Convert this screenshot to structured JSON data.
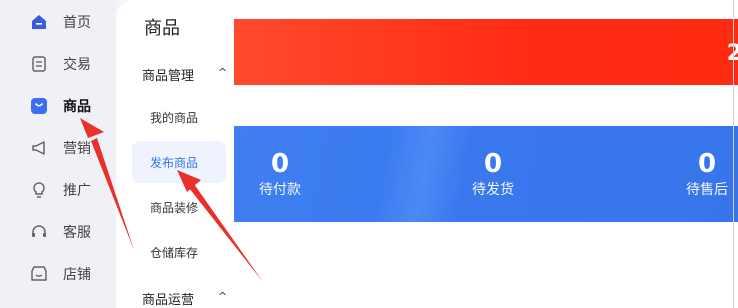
{
  "sidebar": {
    "items": [
      {
        "label": "首页",
        "icon": "home-icon"
      },
      {
        "label": "交易",
        "icon": "receipt-icon"
      },
      {
        "label": "商品",
        "icon": "shopping-bag-icon"
      },
      {
        "label": "营销",
        "icon": "megaphone-icon"
      },
      {
        "label": "推广",
        "icon": "lightbulb-icon"
      },
      {
        "label": "客服",
        "icon": "headset-icon"
      },
      {
        "label": "店铺",
        "icon": "storefront-icon"
      }
    ],
    "active_index": 2
  },
  "submenu": {
    "title": "商品",
    "groups": [
      {
        "label": "商品管理",
        "caret": "^",
        "items": [
          "我的商品",
          "发布商品",
          "商品装修",
          "仓储库存"
        ],
        "active_item": "发布商品"
      },
      {
        "label": "商品运营",
        "caret": "^"
      }
    ]
  },
  "banner": {
    "value_fragment": "2"
  },
  "stats": [
    {
      "value": "0",
      "label": "待付款"
    },
    {
      "value": "0",
      "label": "待发货"
    },
    {
      "value": "0",
      "label": "待售后"
    }
  ],
  "colors": {
    "accent_blue": "#3574ee",
    "banner_red": "#ff2a12",
    "arrow_red": "#e8312a",
    "active_icon_bg": "#3b6ef0"
  }
}
